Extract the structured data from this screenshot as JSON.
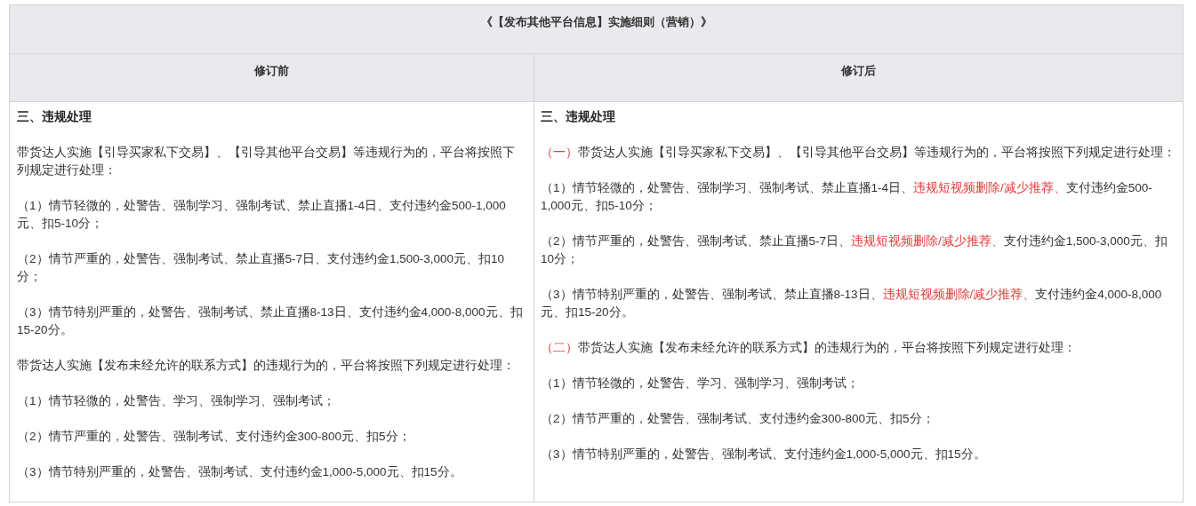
{
  "title": "《【发布其他平台信息】实施细则（营销）》",
  "columns": [
    {
      "heading": "修订前",
      "paragraphs": [
        {
          "kind": "heading",
          "segments": [
            {
              "text": "三、违规处理",
              "highlighted": false
            }
          ]
        },
        {
          "kind": "body",
          "segments": [
            {
              "text": "带货达人实施【引导买家私下交易】、【引导其他平台交易】等违规行为的，平台将按照下列规定进行处理：",
              "highlighted": false
            }
          ]
        },
        {
          "kind": "body",
          "segments": [
            {
              "text": "（1）情节轻微的，处警告、强制学习、强制考试、禁止直播1-4日、支付违约金500-1,000元、扣5-10分；",
              "highlighted": false
            }
          ]
        },
        {
          "kind": "body",
          "segments": [
            {
              "text": "（2）情节严重的，处警告、强制考试、禁止直播5-7日、支付违约金1,500-3,000元、扣10分；",
              "highlighted": false
            }
          ]
        },
        {
          "kind": "body",
          "segments": [
            {
              "text": "（3）情节特别严重的，处警告、强制考试、禁止直播8-13日、支付违约金4,000-8,000元、扣15-20分。",
              "highlighted": false
            }
          ]
        },
        {
          "kind": "body",
          "segments": [
            {
              "text": "带货达人实施【发布未经允许的联系方式】的违规行为的，平台将按照下列规定进行处理：",
              "highlighted": false
            }
          ]
        },
        {
          "kind": "body",
          "segments": [
            {
              "text": "（1）情节轻微的，处警告、学习、强制学习、强制考试；",
              "highlighted": false
            }
          ]
        },
        {
          "kind": "body",
          "segments": [
            {
              "text": "（2）情节严重的，处警告、强制考试、支付违约金300-800元、扣5分；",
              "highlighted": false
            }
          ]
        },
        {
          "kind": "body",
          "segments": [
            {
              "text": "（3）情节特别严重的，处警告、强制考试、支付违约金1,000-5,000元、扣15分。",
              "highlighted": false
            }
          ]
        }
      ]
    },
    {
      "heading": "修订后",
      "paragraphs": [
        {
          "kind": "heading",
          "segments": [
            {
              "text": "三、违规处理",
              "highlighted": false
            }
          ]
        },
        {
          "kind": "body",
          "segments": [
            {
              "text": "（一）",
              "highlighted": true
            },
            {
              "text": "带货达人实施【引导买家私下交易】、【引导其他平台交易】等违规行为的，平台将按照下列规定进行处理：",
              "highlighted": false
            }
          ]
        },
        {
          "kind": "body",
          "segments": [
            {
              "text": "（1）情节轻微的，处警告、强制学习、强制考试、禁止直播1-4日、",
              "highlighted": false
            },
            {
              "text": "违规短视频删除/减少推荐、",
              "highlighted": true
            },
            {
              "text": "支付违约金500-1,000元、扣5-10分；",
              "highlighted": false
            }
          ]
        },
        {
          "kind": "body",
          "segments": [
            {
              "text": "（2）情节严重的，处警告、强制考试、禁止直播5-7日、",
              "highlighted": false
            },
            {
              "text": "违规短视频删除/减少推荐、",
              "highlighted": true
            },
            {
              "text": "支付违约金1,500-3,000元、扣10分；",
              "highlighted": false
            }
          ]
        },
        {
          "kind": "body",
          "segments": [
            {
              "text": "（3）情节特别严重的，处警告、强制考试、禁止直播8-13日、",
              "highlighted": false
            },
            {
              "text": "违规短视频删除/减少推荐、",
              "highlighted": true
            },
            {
              "text": "支付违约金4,000-8,000元、扣15-20分。",
              "highlighted": false
            }
          ]
        },
        {
          "kind": "body",
          "segments": [
            {
              "text": "（二）",
              "highlighted": true
            },
            {
              "text": "带货达人实施【发布未经允许的联系方式】的违规行为的，平台将按照下列规定进行处理：",
              "highlighted": false
            }
          ]
        },
        {
          "kind": "body",
          "segments": [
            {
              "text": "（1）情节轻微的，处警告、学习、强制学习、强制考试；",
              "highlighted": false
            }
          ]
        },
        {
          "kind": "body",
          "segments": [
            {
              "text": "（2）情节严重的，处警告、强制考试、支付违约金300-800元、扣5分；",
              "highlighted": false
            }
          ]
        },
        {
          "kind": "body",
          "segments": [
            {
              "text": "（3）情节特别严重的，处警告、强制考试、支付违约金1,000-5,000元、扣15分。",
              "highlighted": false
            }
          ]
        }
      ]
    }
  ]
}
